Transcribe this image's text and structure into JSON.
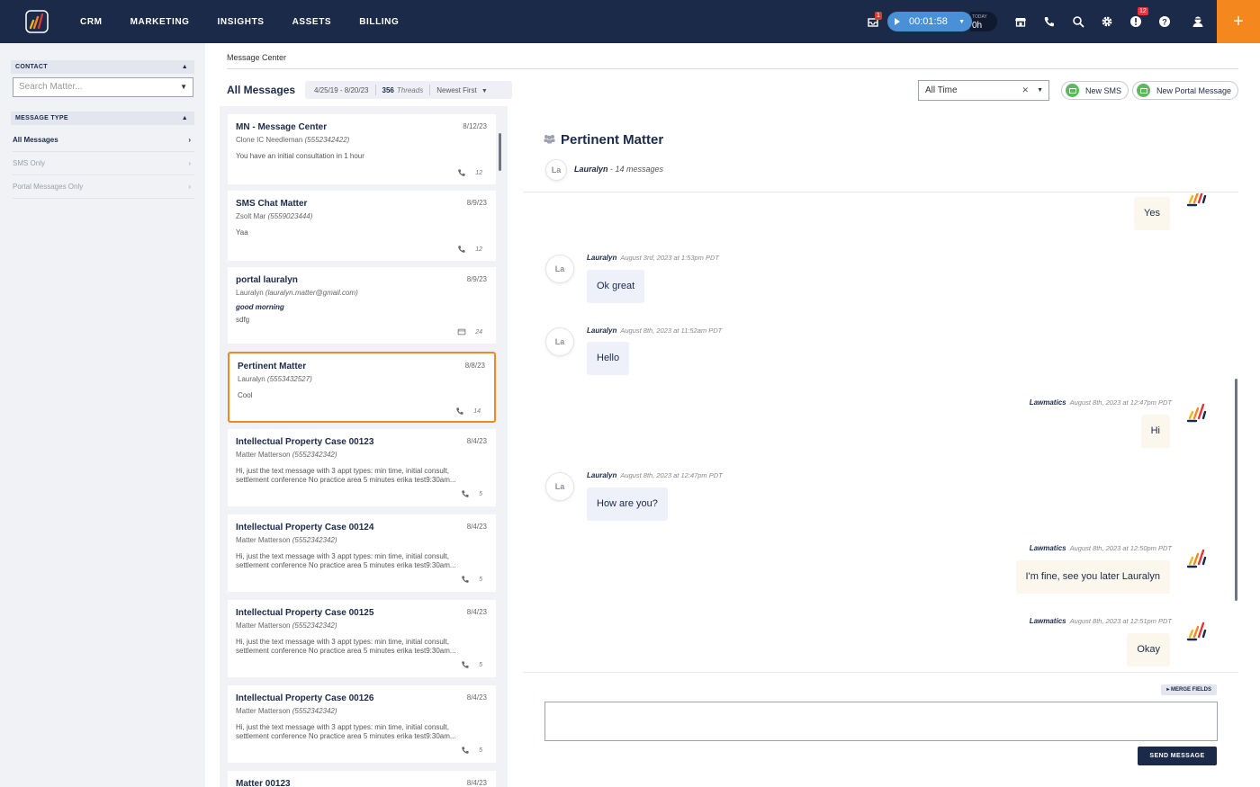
{
  "nav": {
    "links": [
      "CRM",
      "MARKETING",
      "INSIGHTS",
      "ASSETS",
      "BILLING"
    ],
    "inbox_badge": "1",
    "timer": "00:01:58",
    "today_label": "TODAY",
    "today_value": "0h",
    "alert_badge": "12",
    "plus": "+"
  },
  "sidebar": {
    "contact_header": "CONTACT",
    "search_placeholder": "Search Matter...",
    "message_type_header": "MESSAGE TYPE",
    "items": [
      {
        "label": "All Messages",
        "active": true
      },
      {
        "label": "SMS Only",
        "active": false
      },
      {
        "label": "Portal Messages Only",
        "active": false
      }
    ]
  },
  "main": {
    "breadcrumb": "Message Center",
    "title": "All Messages",
    "date_range": "4/25/19 - 8/20/23",
    "thread_count": "356",
    "threads_label": "Threads",
    "sort": "Newest First",
    "time_filter": "All Time",
    "new_sms": "New SMS",
    "new_portal": "New Portal Message"
  },
  "threads": [
    {
      "title": "MN - Message Center",
      "date": "8/12/23",
      "contact": "Clone IC Needleman",
      "phone": "(5552342422)",
      "preview": "You have an initial consultation in 1 hour",
      "count": "12",
      "type": "phone"
    },
    {
      "title": "SMS Chat Matter",
      "date": "8/9/23",
      "contact": "Zsolt Mar",
      "phone": "(5559023444)",
      "preview": "Yaa",
      "count": "12",
      "type": "phone"
    },
    {
      "title": "portal lauralyn",
      "date": "8/9/23",
      "contact": "Lauralyn",
      "phone": "(lauralyn.matter@gmail.com)",
      "preview_bold": "good morning",
      "preview": "sdfg",
      "count": "24",
      "type": "portal"
    },
    {
      "title": "Pertinent Matter",
      "date": "8/8/23",
      "contact": "Lauralyn",
      "phone": "(5553432527)",
      "preview": "Cool",
      "count": "14",
      "type": "phone"
    },
    {
      "title": "Intellectual Property Case 00123",
      "date": "8/4/23",
      "contact": "Matter Matterson",
      "phone": "(5552342342)",
      "preview": "Hi, just the text message with 3 appt types: min time, initial consult, settlement conference No practice area 5 minutes erika test9:30am...",
      "count": "5",
      "type": "phone"
    },
    {
      "title": "Intellectual Property Case 00124",
      "date": "8/4/23",
      "contact": "Matter Matterson",
      "phone": "(5552342342)",
      "preview": "Hi, just the text message with 3 appt types: min time, initial consult, settlement conference No practice area 5 minutes erika test9:30am...",
      "count": "5",
      "type": "phone"
    },
    {
      "title": "Intellectual Property Case 00125",
      "date": "8/4/23",
      "contact": "Matter Matterson",
      "phone": "(5552342342)",
      "preview": "Hi, just the text message with 3 appt types: min time, initial consult, settlement conference No practice area 5 minutes erika test9:30am...",
      "count": "5",
      "type": "phone"
    },
    {
      "title": "Intellectual Property Case 00126",
      "date": "8/4/23",
      "contact": "Matter Matterson",
      "phone": "(5552342342)",
      "preview": "Hi, just the text message with 3 appt types: min time, initial consult, settlement conference No practice area 5 minutes erika test9:30am...",
      "count": "5",
      "type": "phone"
    },
    {
      "title": "Matter 00123",
      "date": "8/4/23"
    }
  ],
  "conversation": {
    "title": "Pertinent Matter",
    "participant_initials": "La",
    "participant": "Lauralyn",
    "message_count": "14 messages",
    "messages": [
      {
        "dir": "out",
        "text": "Yes"
      },
      {
        "dir": "in",
        "sender": "Lauralyn",
        "time": "August 3rd, 2023 at 1:53pm PDT",
        "text": "Ok great"
      },
      {
        "dir": "in",
        "sender": "Lauralyn",
        "time": "August 8th, 2023 at 11:52am PDT",
        "text": "Hello"
      },
      {
        "dir": "out",
        "sender": "Lawmatics",
        "time": "August 8th, 2023 at 12:47pm PDT",
        "text": "Hi"
      },
      {
        "dir": "in",
        "sender": "Lauralyn",
        "time": "August 8th, 2023 at 12:47pm PDT",
        "text": "How are you?"
      },
      {
        "dir": "out",
        "sender": "Lawmatics",
        "time": "August 8th, 2023 at 12:50pm PDT",
        "text": "I'm fine, see you later Lauralyn"
      },
      {
        "dir": "out",
        "sender": "Lawmatics",
        "time": "August 8th, 2023 at 12:51pm PDT",
        "text": "Okay"
      }
    ],
    "merge_fields": "▸ MERGE FIELDS",
    "send_label": "SEND MESSAGE"
  },
  "colors": {
    "navy": "#1b2a48",
    "orange": "#f5871f",
    "green": "#5cb85c",
    "timer_blue": "#4a90d6"
  },
  "icons": [
    "logo-icon",
    "inbox-icon",
    "play-icon",
    "store-icon",
    "phone-icon",
    "search-icon",
    "gear-icon",
    "alert-icon",
    "help-icon",
    "user-icon",
    "people-icon",
    "portal-icon"
  ]
}
